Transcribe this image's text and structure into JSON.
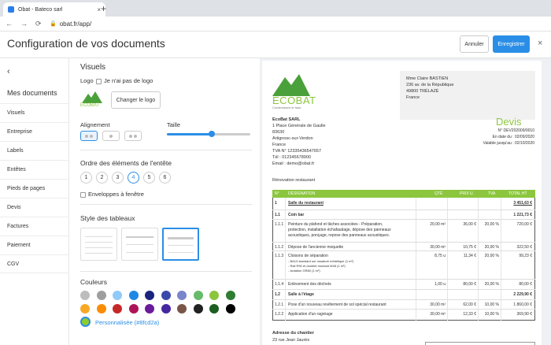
{
  "browser": {
    "tab_title": "Obat - Bateco sarl",
    "tab_close": "×",
    "new_tab": "+",
    "nav_back": "←",
    "nav_forward": "→",
    "nav_reload": "⟳",
    "lock": "🔒",
    "url": "obat.fr/app/"
  },
  "header": {
    "title": "Configuration de vos documents",
    "cancel_label": "Annuler",
    "save_label": "Enregistrer",
    "close": "×"
  },
  "sidebar": {
    "back": "‹",
    "title": "Mes documents",
    "items": [
      "Visuels",
      "Entreprise",
      "Labels",
      "Entêtes",
      "Pieds de pages",
      "Devis",
      "Factures",
      "Paiement",
      "CGV"
    ]
  },
  "options": {
    "section_title": "Visuels",
    "logo_label": "Logo",
    "no_logo_label": "Je n'ai pas de logo",
    "change_logo": "Changer le logo",
    "alignment_label": "Alignement",
    "size_label": "Taille",
    "size_value_percent": 53,
    "order_title": "Ordre des éléments de l'entête",
    "order_items": [
      "1",
      "2",
      "3",
      "4",
      "5",
      "6"
    ],
    "order_selected": "4",
    "envelope_label": "Enveloppes à fenêtre",
    "table_style_title": "Style des tableaux",
    "colors_title": "Couleurs",
    "colors": [
      "#bdbdbd",
      "#9e9e9e",
      "#90caf9",
      "#1e88e5",
      "#1a237e",
      "#3949ab",
      "#7986cb",
      "#66bb6a",
      "#8cc63e",
      "#2e7d32",
      "#f9a825",
      "#fb8c00",
      "#c62828",
      "#ad1457",
      "#6a1b9a",
      "#4527a0",
      "#795548",
      "#212121",
      "#1b5e20",
      "#000000"
    ],
    "custom_color_label": "Personnalisée (#8fcd2a)",
    "custom_color": "#8fcd2a"
  },
  "preview": {
    "logo_text": "ECOBAT",
    "logo_sub": "Construisons le futur",
    "client": {
      "name": "Mme Claire BASTIEN",
      "line1": "236 av. de la République",
      "line2": "49800 TRÉLAZÉ",
      "line3": "France"
    },
    "company": {
      "name": "EcoBat SARL",
      "lines": [
        "1 Place Générale de Gaulle",
        "83630",
        "Artignosc-sur-Verdon",
        "France",
        "TVA N° 12335436547657",
        "Tél : 012345678900",
        "Email : demo@obat.fr"
      ]
    },
    "doc_title": "Devis",
    "doc_num": "N° DEV202009/0010",
    "doc_date": "En date du : 02/09/2020",
    "doc_valid": "Valable jusqu'au : 02/10/2020",
    "project": "Rénovation restaurant",
    "columns": [
      "N°",
      "DÉSIGNATION",
      "QTÉ",
      "PRIX U.",
      "TVA",
      "TOTAL HT"
    ],
    "rows": [
      {
        "n": "1",
        "d": "Salle du restaurant",
        "q": "",
        "p": "",
        "t": "",
        "tot": "3 451,63 €"
      },
      {
        "n": "1.1",
        "d": "Coin bar",
        "q": "",
        "p": "",
        "t": "",
        "tot": "1 221,73 €"
      },
      {
        "n": "1.1.1",
        "d": "Peinture du plafond et tâches associées - Préparation,",
        "d2": "protection, installation échafaudage, dépose des panneaux",
        "d3": "acoustiques, ponçage, repose des panneaux acoustiques.",
        "q": "20,00 m²",
        "p": "36,00 €",
        "t": "20,00 %",
        "tot": "720,00 €"
      },
      {
        "n": "1.1.2",
        "d": "Dépose de l'ancienne moquette",
        "q": "30,00 m²",
        "p": "10,75 €",
        "t": "20,00 %",
        "tot": "322,50 €"
      },
      {
        "n": "1.1.3",
        "d": "Cloisons de séparation",
        "d2": "- BA13 standard sur ossature métallique (1 m²)",
        "d3": "- Rail R90 et doublet montant M48 (1 m²)",
        "d4": "- Isolation GR80 (1 m²)",
        "q": "8,75 u",
        "p": "11,34 €",
        "t": "20,00 %",
        "tot": "99,23 €"
      },
      {
        "n": "1.1.4",
        "d": "Enlèvement des déchets",
        "q": "1,00 u",
        "p": "80,00 €",
        "t": "20,00 %",
        "tot": "80,00 €"
      },
      {
        "n": "1.2",
        "d": "Salle à l'étage",
        "q": "",
        "p": "",
        "t": "",
        "tot": "2 229,90 €"
      },
      {
        "n": "1.2.1",
        "d": "Pose d'un nouveau revêtement de sol spécial restaurant",
        "q": "30,00 m²",
        "p": "62,00 €",
        "t": "10,00 %",
        "tot": "1 860,00 €"
      },
      {
        "n": "1.2.2",
        "d": "Application d'un ragréage",
        "q": "30,00 m²",
        "p": "12,33 €",
        "t": "10,00 %",
        "tot": "369,90 €"
      }
    ],
    "site_label": "Adresse du chantier",
    "site_line": "23 rue Jean Jaurès"
  }
}
